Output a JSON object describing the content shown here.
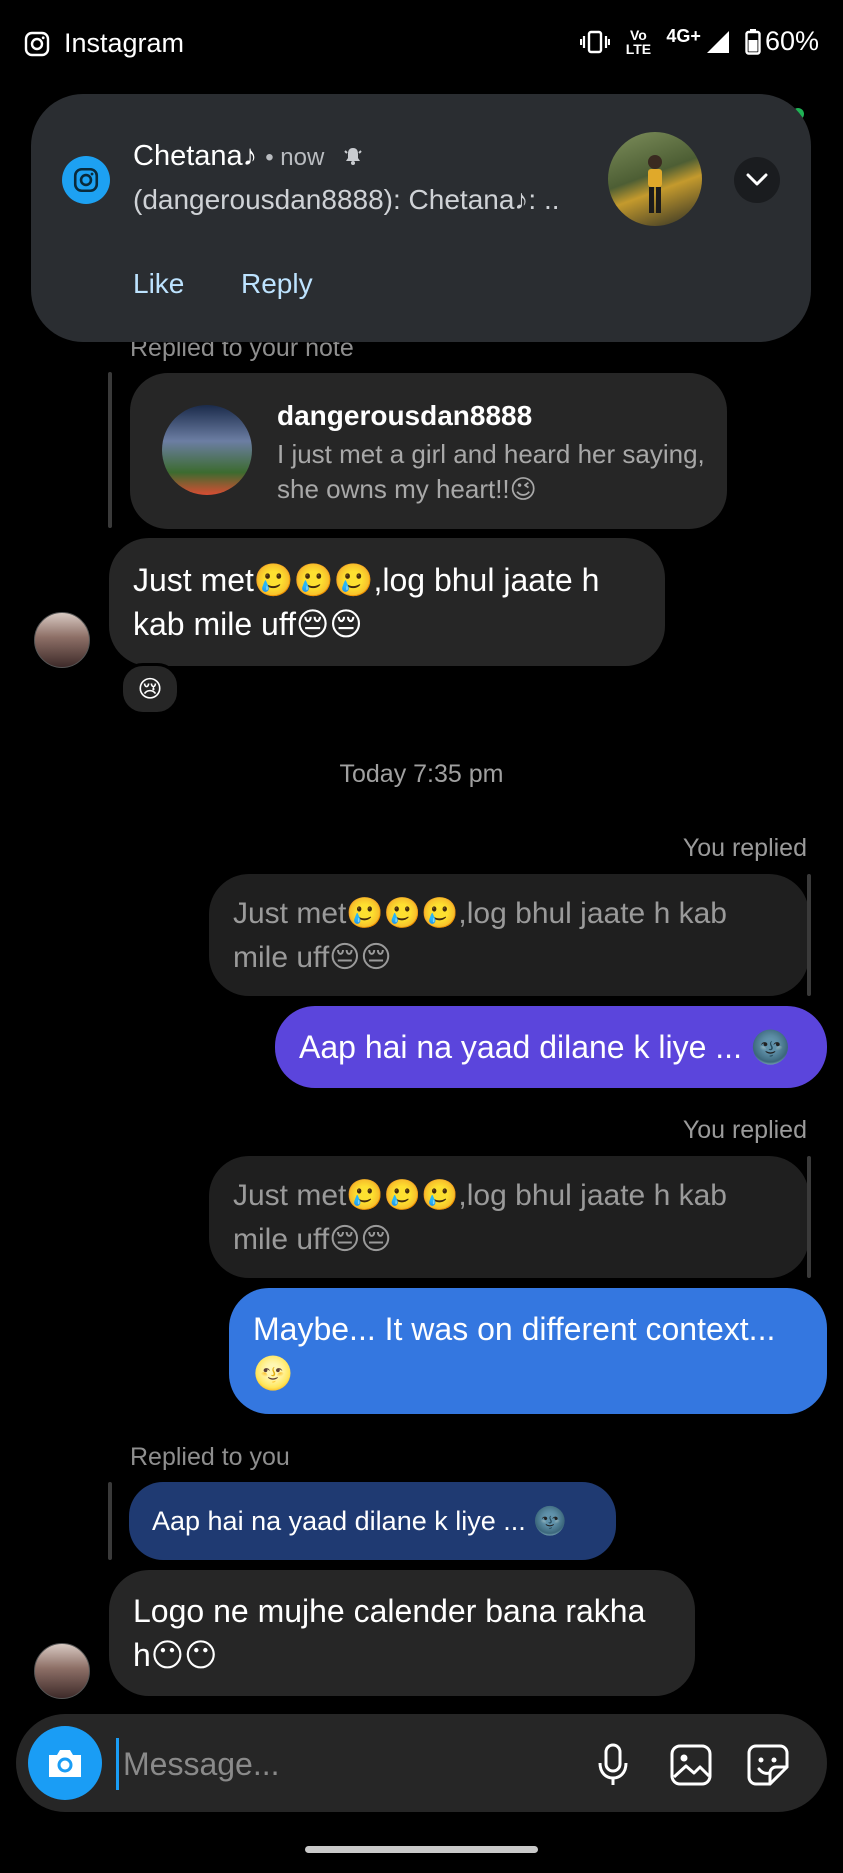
{
  "status_bar": {
    "app_name": "Instagram",
    "volte": "Vo LTE",
    "network": "4G+",
    "battery": "60%"
  },
  "notification": {
    "sender": "Chetana♪",
    "time": "• now",
    "body": "(dangerousdan8888): Chetana♪: ..",
    "actions": [
      "Like",
      "Reply"
    ]
  },
  "chat": {
    "note_reply_label": "Replied to your note",
    "note": {
      "username": "dangerousdan8888",
      "text": "I just met a girl and heard her saying, she owns my heart!!😉"
    },
    "message1": "Just met🥲🥲🥲,log bhul jaate h kab mile uff😔😔",
    "message1_reaction": "😢",
    "timestamp": "Today 7:35 pm",
    "reply1": {
      "label": "You replied",
      "quoted": "Just met🥲🥲🥲,log bhul jaate h kab mile uff😔😔",
      "text": "Aap hai na yaad dilane k liye ... 🌚"
    },
    "reply2": {
      "label": "You replied",
      "quoted": "Just met🥲🥲🥲,log bhul jaate h kab mile uff😔😔",
      "text": "Maybe... It was on different context... 🌝"
    },
    "reply3": {
      "label": "Replied to you",
      "quoted": "Aap hai na yaad dilane k liye ... 🌚",
      "text": "Logo ne mujhe calender bana rakha h😶😶"
    }
  },
  "composer": {
    "placeholder": "Message..."
  },
  "colors": {
    "purple_bubble": "#5b45dc",
    "blue_bubble": "#3477e0",
    "accent": "#1a9df5"
  },
  "icons": [
    "instagram-icon",
    "vibrate-icon",
    "signal-icon",
    "battery-icon",
    "notification-bell-icon",
    "chevron-down-icon",
    "camera-icon",
    "microphone-icon",
    "gallery-icon",
    "sticker-icon"
  ]
}
